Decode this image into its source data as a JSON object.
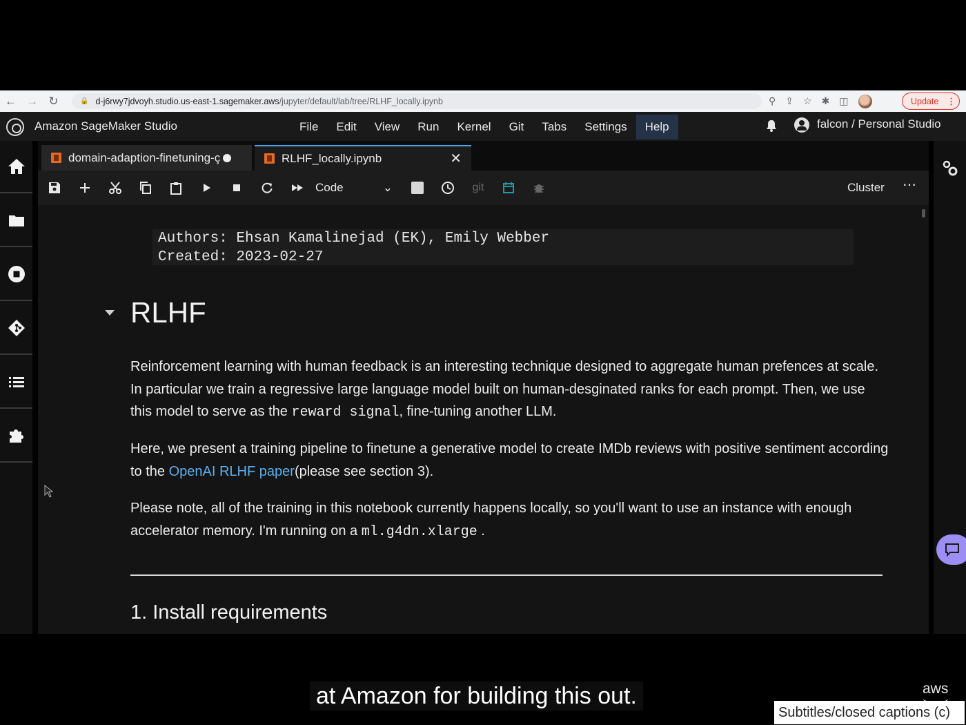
{
  "browser": {
    "url_host": "d-j6rwy7jdvoyh.studio.us-east-1.sagemaker.aws",
    "url_path": "/jupyter/default/lab/tree/RLHF_locally.ipynb",
    "update_label": "Update"
  },
  "header": {
    "app_title": "Amazon SageMaker Studio",
    "menu": [
      "File",
      "Edit",
      "View",
      "Run",
      "Kernel",
      "Git",
      "Tabs",
      "Settings",
      "Help"
    ],
    "active_menu": "Help",
    "user": "falcon / Personal Studio"
  },
  "tabs": [
    {
      "label": "domain-adaption-finetuning-ç",
      "dirty": true
    },
    {
      "label": "RLHF_locally.ipynb",
      "active": true
    }
  ],
  "toolbar": {
    "cell_type": "Code",
    "git_label": "git",
    "kernel": "Cluster"
  },
  "notebook": {
    "authors_line": "Authors: Ehsan Kamalinejad (EK), Emily Webber",
    "created_line": "Created: 2023-02-27",
    "heading": "RLHF",
    "p1_a": "Reinforcement learning with human feedback is an interesting technique designed to aggregate human prefences at scale. In particular we train a regressive large language model built on human-desginated ranks for each prompt. Then, we use this model to serve as the ",
    "p1_code": "reward signal",
    "p1_b": ", fine-tuning another LLM.",
    "p2_a": "Here, we present a training pipeline to finetune a generative model to create IMDb reviews with positive sentiment according to the ",
    "p2_link": "OpenAI RLHF paper",
    "p2_b": "(please see section 3).",
    "p3_a": "Please note, all of the training in this notebook currently happens locally, so you'll want to use an instance with enough accelerator memory. I'm running on a ",
    "p3_code": "ml.g4dn.xlarge",
    "p3_b": " .",
    "section_heading": "1. Install requirements"
  },
  "caption": {
    "text": "at Amazon for building this out.",
    "brand": "aws",
    "cc_label": "Subtitles/closed captions (c)"
  },
  "colors": {
    "accent": "#4ba3f0",
    "active_menu_bg": "#253348",
    "link": "#5ab0f0",
    "notebook_icon": "#e46a27",
    "update": "#d93025",
    "feedback": "#9d8ef5"
  }
}
